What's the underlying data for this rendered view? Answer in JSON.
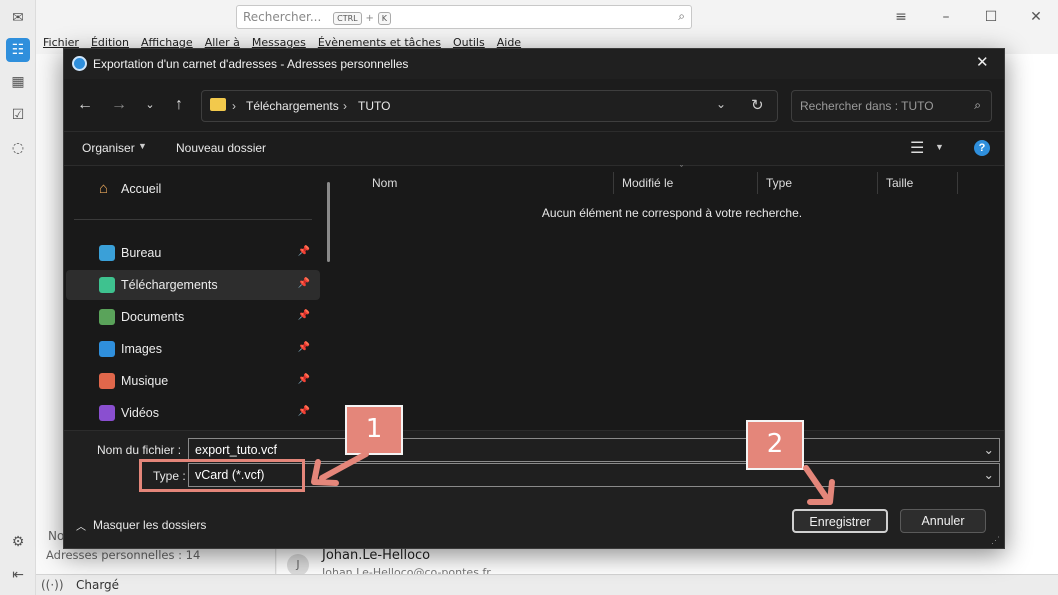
{
  "app": {
    "search_placeholder": "Rechercher...",
    "search_kbd_1": "CTRL",
    "search_kbd_plus": "+",
    "search_kbd_2": "K",
    "menu": [
      "Fichier",
      "Édition",
      "Affichage",
      "Aller à",
      "Messages",
      "Évènements et tâches",
      "Outils",
      "Aide"
    ],
    "left_panel_status_1": "No",
    "left_panel_status_2": "Adresses personnelles : 14",
    "contact_name": "Johan.Le-Helloco",
    "contact_initial": "J",
    "contact_email": "Johan.Le-Helloco@co-pontes.fr",
    "status": "Chargé"
  },
  "dialog": {
    "title": "Exportation d'un carnet d'adresses - Adresses personnelles",
    "breadcrumb": [
      "Téléchargements",
      "TUTO"
    ],
    "search_placeholder": "Rechercher dans : TUTO",
    "organize_label": "Organiser",
    "new_folder_label": "Nouveau dossier",
    "nav": {
      "home": "Accueil",
      "items": [
        {
          "label": "Bureau",
          "icon": "desktop-icon",
          "color": "#3aa0d8"
        },
        {
          "label": "Téléchargements",
          "icon": "download-icon",
          "color": "#3ec28f",
          "selected": true
        },
        {
          "label": "Documents",
          "icon": "document-icon",
          "color": "#5aa35a"
        },
        {
          "label": "Images",
          "icon": "image-icon",
          "color": "#2f8fdc"
        },
        {
          "label": "Musique",
          "icon": "music-icon",
          "color": "#e0674b"
        },
        {
          "label": "Vidéos",
          "icon": "video-icon",
          "color": "#8a4fd0"
        }
      ]
    },
    "columns": [
      "Nom",
      "Modifié le",
      "Type",
      "Taille"
    ],
    "empty_message": "Aucun élément ne correspond à votre recherche.",
    "filename_label": "Nom du fichier :",
    "filename_value": "export_tuto.vcf",
    "type_label": "Type :",
    "type_value": "vCard (*.vcf)",
    "hide_folders_label": "Masquer les dossiers",
    "save_label": "Enregistrer",
    "cancel_label": "Annuler"
  },
  "annotations": {
    "callout_1": "1",
    "callout_2": "2",
    "accent": "#e4867a"
  }
}
